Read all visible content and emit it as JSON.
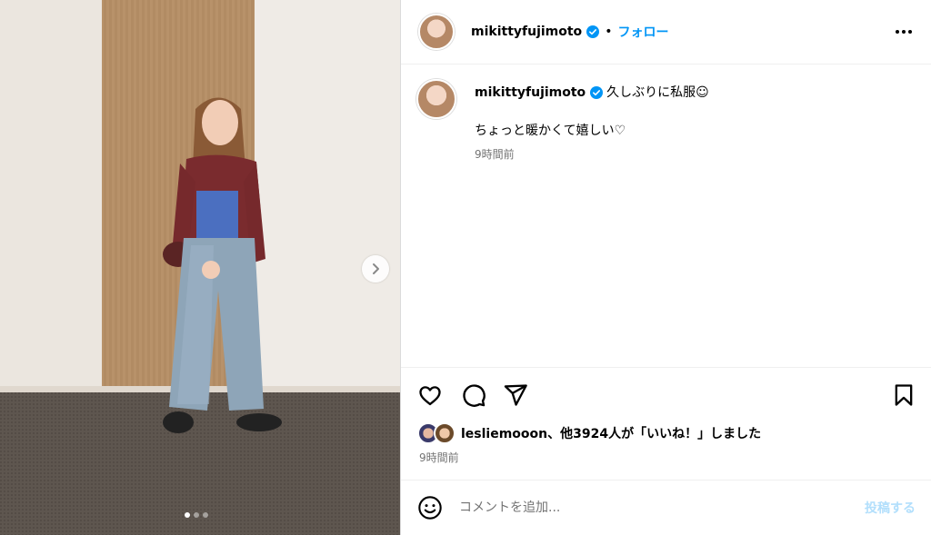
{
  "post": {
    "username": "mikittyfujimoto",
    "separator": "•",
    "follow_label": "フォロー",
    "caption_line1": "久しぶりに私服☺︎",
    "caption_line2": "ちょっと暖かくて嬉しい♡",
    "caption_time": "9時間前",
    "likes_text": "lesliemooon、他3924人が「いいね！」しました",
    "post_time": "9時間前",
    "comment_placeholder": "コメントを追加...",
    "post_label": "投稿する"
  },
  "media": {
    "slide_count": 3,
    "active_slide": 1
  },
  "icons": {
    "verified": "verified-badge-icon",
    "more": "more-options-icon",
    "like": "heart-icon",
    "comment": "comment-bubble-icon",
    "share": "paper-plane-icon",
    "save": "bookmark-icon",
    "emoji": "smiley-icon",
    "next": "chevron-right-icon"
  },
  "colors": {
    "accent": "#0095f6",
    "verified": "#0095f6",
    "post_disabled": "#b2dffc",
    "muted": "#737373"
  }
}
